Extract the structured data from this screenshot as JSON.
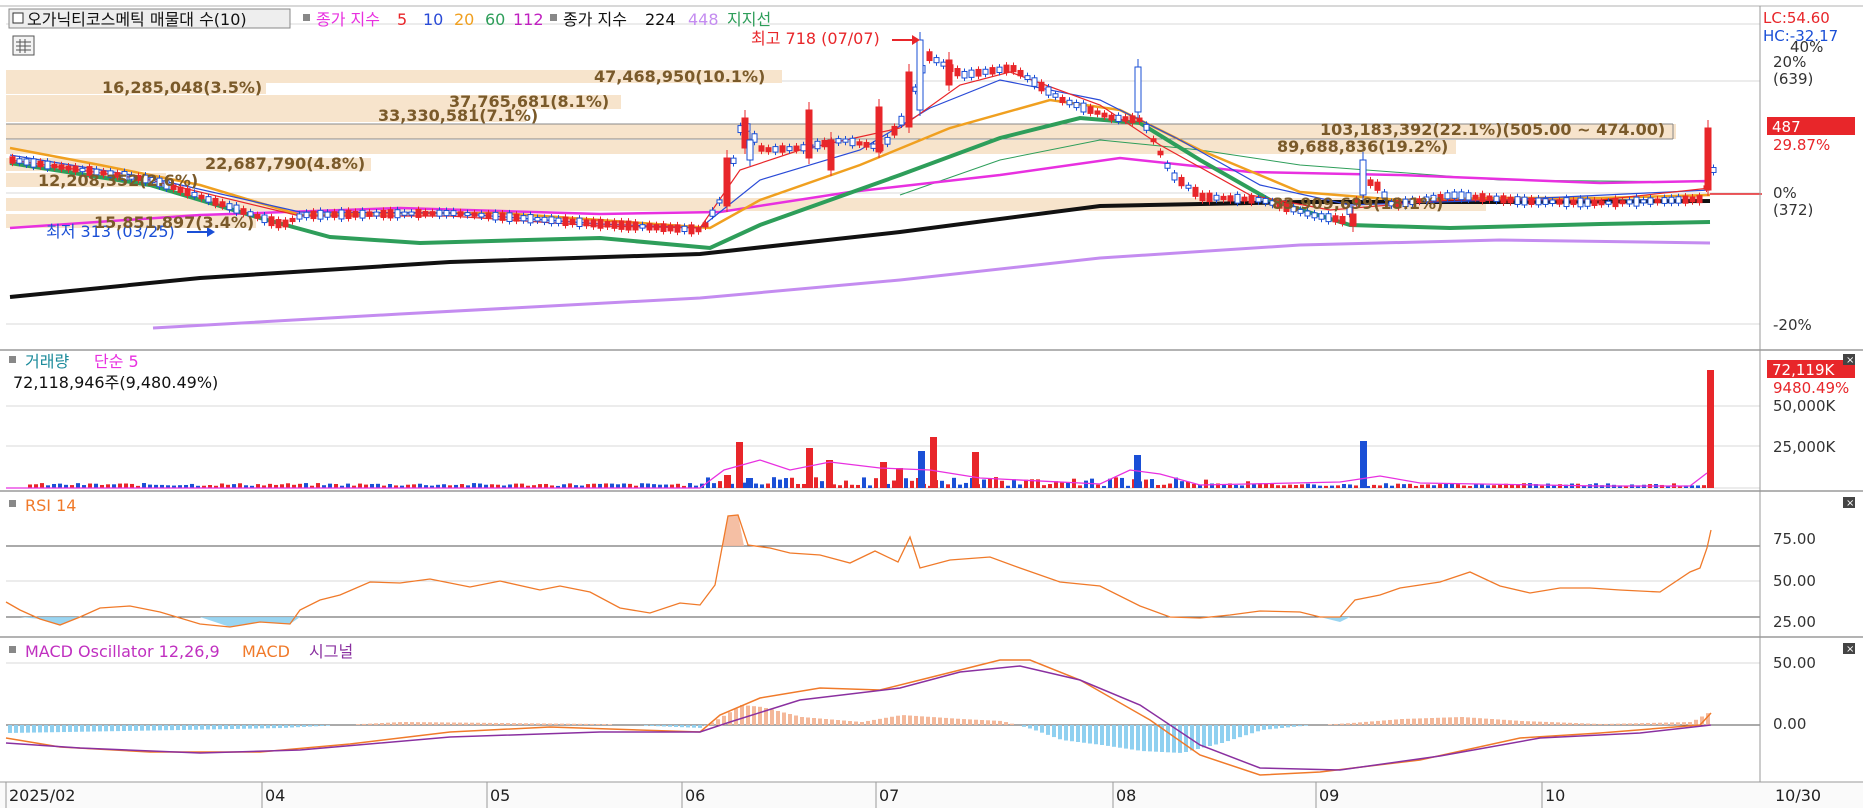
{
  "header": {
    "stock_name": "오가닉티코스메틱 매물대 수(10)",
    "ma_title": "종가 지수",
    "ma_periods": [
      "5",
      "10",
      "20",
      "60",
      "112"
    ],
    "ma_long_title": "종가 지수",
    "ma_long_periods": [
      "224",
      "448"
    ],
    "support_label": "지지선"
  },
  "right_axis": {
    "lc": "LC:54.60",
    "hc": "HC:-32.17",
    "pct_labels": [
      "40%",
      "20%",
      "(639)",
      "0%",
      "(372)",
      "-20%"
    ],
    "current_price": "487",
    "current_change": "29.87%"
  },
  "annotations": {
    "high": "최고 718 (07/07)",
    "low": "최저 313 (03/25)"
  },
  "volume_profile_labels": [
    "47,468,950(10.1%)",
    "37,765,681(8.1%)",
    "33,330,581(7.1%)",
    "16,285,048(3.5%)",
    "22,687,790(4.8%)",
    "103,183,392(22.1%)(505.00 ~ 474.00)",
    "89,688,836(19.2%)",
    "12,208,352(2.6%)",
    "15,851,897(3.4%)",
    "83,909,699(18.1%)"
  ],
  "volume_panel": {
    "title": "거래량",
    "ma_label": "단순 5",
    "value_text": "72,118,946주(9,480.49%)",
    "current_label": "72,119K",
    "current_pct": "9480.49%",
    "y_ticks": [
      "50,000K",
      "25,000K"
    ]
  },
  "rsi_panel": {
    "title": "RSI 14",
    "y_ticks": [
      "75.00",
      "50.00",
      "25.00"
    ]
  },
  "macd_panel": {
    "title": "MACD Oscillator 12,26,9",
    "macd_label": "MACD",
    "signal_label": "시그널",
    "y_ticks": [
      "50.00",
      "0.00"
    ]
  },
  "x_axis": {
    "labels": [
      "2025/02",
      "04",
      "05",
      "06",
      "07",
      "08",
      "09",
      "10"
    ],
    "right_label": "10/30"
  },
  "colors": {
    "up": "#e8262a",
    "down": "#1a4fd6",
    "ma5": "#e8262a",
    "ma10": "#2a4bd7",
    "ma20": "#f0a020",
    "ma60": "#2e9e5a",
    "ma112": "#e830e0",
    "ma224": "#111111",
    "ma448": "#c48cf0",
    "rsi": "#f07a2a",
    "macd": "#f07a2a",
    "signal": "#8a30a0",
    "osc_pos": "#f4b89a",
    "osc_neg": "#8fd0f0",
    "vol_profile": "#f7e4cc"
  },
  "chart_data": {
    "type": "candlestick",
    "title": "오가닉티코스메틱",
    "price_high": 718,
    "price_low": 313,
    "last_price": 487,
    "last_change_pct": 29.87,
    "rsi_range": [
      25,
      75
    ],
    "macd_range": [
      -50,
      50
    ],
    "volume_last": 72118946
  }
}
